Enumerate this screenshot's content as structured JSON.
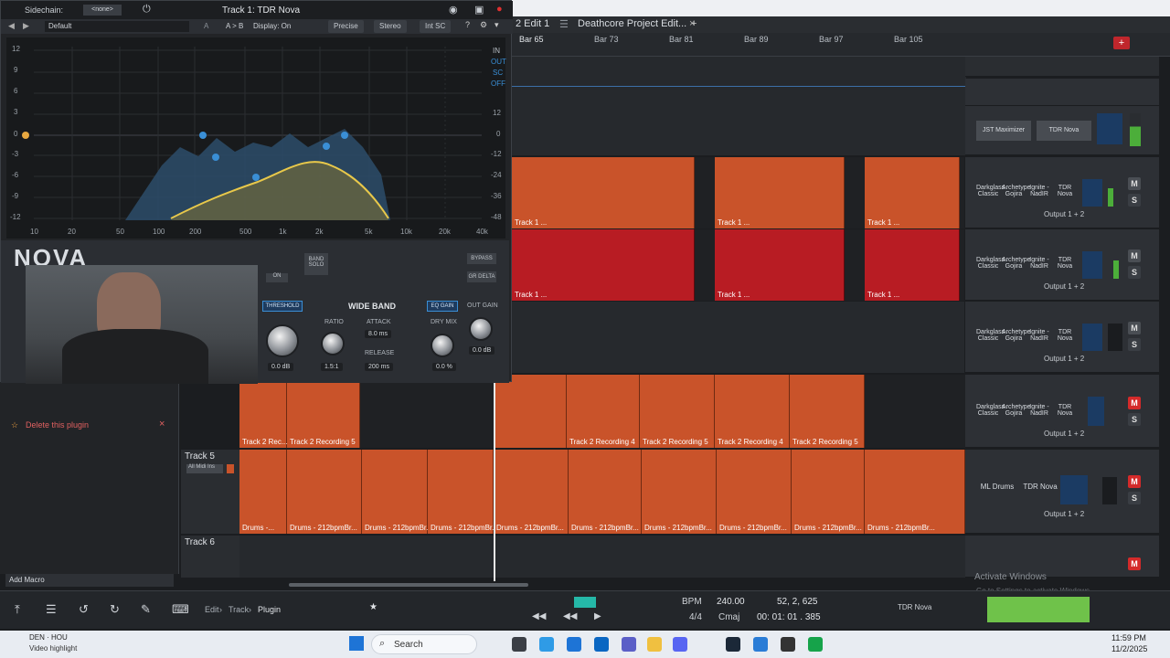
{
  "plugin": {
    "sidechain_label": "Sidechain:",
    "sidechain_value": "<none>",
    "title": "Track 1: TDR Nova",
    "preset": "Default",
    "ab_label": "A",
    "ab2_label": "A > B",
    "display_label": "Display: On",
    "precise_label": "Precise",
    "stereo_label": "Stereo",
    "intsc_label": "Int SC",
    "eq_y_labels": [
      "12",
      "9",
      "6",
      "3",
      "0",
      "-3",
      "-6",
      "-9",
      "-12"
    ],
    "eq_x_labels": [
      "10",
      "20",
      "50",
      "100",
      "200",
      "500",
      "1k",
      "2k",
      "5k",
      "10k",
      "20k",
      "40k"
    ],
    "right_scale_labels": [
      "IN",
      "OUT",
      "SC",
      "OFF",
      "12",
      "0",
      "-12",
      "-24",
      "-36",
      "-48"
    ],
    "logo": "NOVA",
    "band_solo": "BAND SOLO",
    "on_label": "ON",
    "bypass": "BYPASS",
    "gr_delta": "GR DELTA",
    "threshold": "THRESHOLD",
    "wide_band": "WIDE BAND",
    "ratio_label": "RATIO",
    "attack_label": "ATTACK",
    "attack_value": "8.0 ms",
    "release_label": "RELEASE",
    "release_value": "200 ms",
    "threshold_value": "0.0 dB",
    "ratio_value": "1.5:1",
    "eq_gain": "EQ GAIN",
    "dry_mix": "DRY MIX",
    "dry_value": "0.0 %",
    "out_gain": "OUT GAIN",
    "out_value": "0.0 dB"
  },
  "host": {
    "tab_active": "2 Edit 1",
    "tab_project": "Deathcore Project Edit...",
    "bars": [
      "Bar 65",
      "Bar 73",
      "Bar 81",
      "Bar 89",
      "Bar 97",
      "Bar 105"
    ],
    "delete_plugin": "Delete this plugin",
    "track5": "Track 5",
    "track6": "Track 6",
    "track5_input": "All Midi Ins",
    "add_macro": "Add Macro",
    "crumb_edit": "Edit",
    "crumb_track": "Track",
    "crumb_plugin": "Plugin",
    "bpm_label": "BPM",
    "bpm_value": "240.00",
    "position": "52, 2, 625",
    "sig": "4/4",
    "key": "Cmaj",
    "time": "00: 01: 01 . 385",
    "master_fx1": "JST Maximizer",
    "master_fx2": "TDR Nova",
    "transport_fx": "TDR Nova",
    "activate1": "Activate Windows",
    "activate2": "Go to Settings to activate Windows."
  },
  "tracks": {
    "track1_clip": "Track 1 ...",
    "track2_clip": "Track 2 Recording 5",
    "track2_clip4": "Track 2 Recording 4",
    "track2_short": "Track 2 Rec...",
    "drums_clip": "Drums - 212bpmBr...",
    "drums_short": "Drums -..."
  },
  "mixer": {
    "fx_a": "Darkglass Classic",
    "fx_b": "Archetype Gojira",
    "fx_c": "Ignite - NadIR",
    "fx_d": "TDR Nova",
    "fx_ml": "ML Drums",
    "output": "Output 1 + 2",
    "m": "M",
    "s": "S"
  },
  "taskbar": {
    "search": "Search",
    "user_line1": "DEN · HOU",
    "user_line2": "Video highlight",
    "time": "11:59 PM",
    "date": "11/2/2025"
  },
  "colors": {
    "clip_orange": "#c9532a",
    "clip_red": "#b81c23",
    "eq_yellow": "#e8c84a",
    "eq_blue": "#3a8fd6",
    "mute_red": "#d42a2a"
  }
}
